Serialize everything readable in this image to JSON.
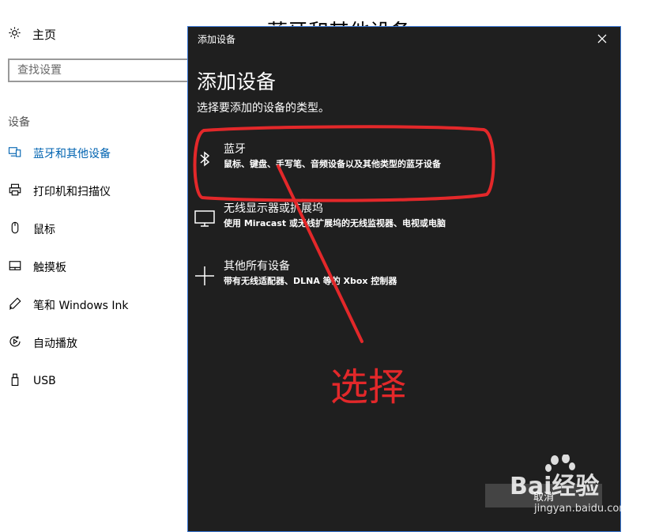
{
  "settings": {
    "home_label": "主页",
    "search_placeholder": "查找设置",
    "section_label": "设备",
    "page_title": "蓝牙和其他设备",
    "items": [
      {
        "label": "蓝牙和其他设备",
        "icon": "bluetooth-devices-icon"
      },
      {
        "label": "打印机和扫描仪",
        "icon": "printer-icon"
      },
      {
        "label": "鼠标",
        "icon": "mouse-icon"
      },
      {
        "label": "触摸板",
        "icon": "touchpad-icon"
      },
      {
        "label": "笔和 Windows Ink",
        "icon": "pen-icon"
      },
      {
        "label": "自动播放",
        "icon": "autoplay-icon"
      },
      {
        "label": "USB",
        "icon": "usb-icon"
      }
    ]
  },
  "dialog": {
    "window_title": "添加设备",
    "heading": "添加设备",
    "subtitle": "选择要添加的设备的类型。",
    "options": [
      {
        "title": "蓝牙",
        "description": "鼠标、键盘、手写笔、音频设备以及其他类型的蓝牙设备",
        "icon": "bluetooth-icon"
      },
      {
        "title": "无线显示器或扩展坞",
        "description": "使用 Miracast 或无线扩展坞的无线监视器、电视或电脑",
        "icon": "monitor-icon"
      },
      {
        "title": "其他所有设备",
        "description": "带有无线适配器、DLNA 等的 Xbox 控制器",
        "icon": "plus-icon"
      }
    ],
    "cancel_label": "取消"
  },
  "annotation": {
    "label": "选择",
    "color": "#e3282a"
  },
  "watermark": {
    "text": "Bai经验",
    "url": "jingyan.baidu.com"
  },
  "colors": {
    "accent": "#0063b1",
    "dialog_bg": "#1f1f1f",
    "dialog_border": "#3a78d6"
  }
}
